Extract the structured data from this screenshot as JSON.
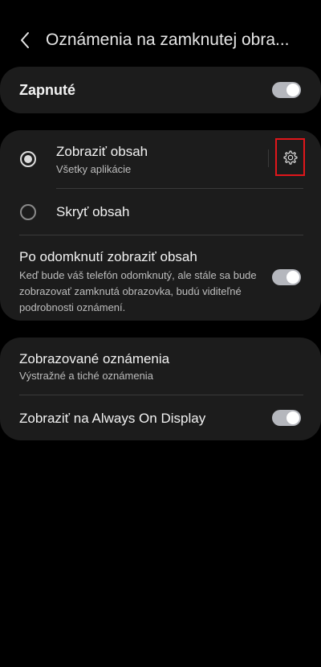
{
  "header": {
    "title": "Oznámenia na zamknutej obra..."
  },
  "main_toggle": {
    "label": "Zapnuté",
    "on": true
  },
  "content_card": {
    "show_content": {
      "label": "Zobraziť obsah",
      "sublabel": "Všetky aplikácie",
      "selected": true
    },
    "hide_content": {
      "label": "Skryť obsah",
      "selected": false
    },
    "after_unlock": {
      "label": "Po odomknutí zobraziť obsah",
      "description": "Keď bude váš telefón odomknutý, ale stále sa bude zobrazovať zamknutá obrazovka, budú viditeľné podrobnosti oznámení.",
      "on": true
    }
  },
  "bottom_card": {
    "shown_notifications": {
      "label": "Zobrazované oznámenia",
      "sublabel": "Výstražné a tiché oznámenia"
    },
    "always_on": {
      "label": "Zobraziť na Always On Display",
      "on": true
    }
  },
  "colors": {
    "background": "#000000",
    "card": "#1c1c1c",
    "toggle_on": "#b5b7bd",
    "highlight_border": "#e0161b"
  },
  "icons": {
    "back": "chevron-left",
    "settings": "gear"
  }
}
